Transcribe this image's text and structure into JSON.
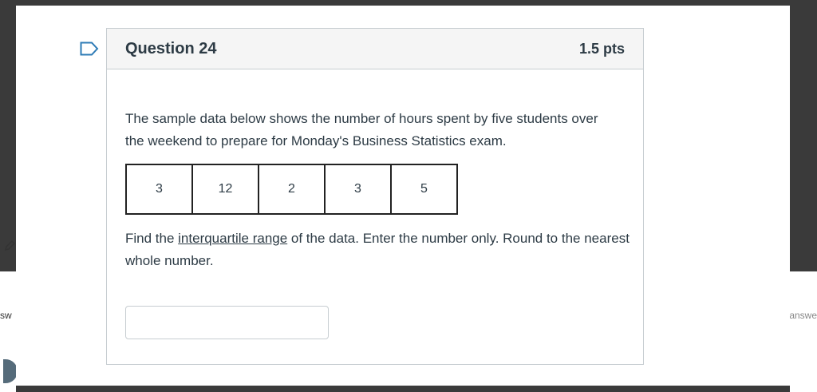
{
  "background": {
    "left_partial_text": "sw",
    "right_partial_text": "answe"
  },
  "question": {
    "title": "Question 24",
    "points": "1.5 pts",
    "prompt": "The sample data below shows the number of hours spent by five students over the weekend to prepare for Monday's Business Statistics exam.",
    "data_values": [
      "3",
      "12",
      "2",
      "3",
      "5"
    ],
    "instruction_before": "Find the ",
    "instruction_link": "interquartile range",
    "instruction_after": " of the data. Enter the number only. Round to the nearest whole number.",
    "answer_value": ""
  },
  "icons": {
    "flag": "bookmark-flag-icon",
    "pencil": "pencil-icon"
  },
  "colors": {
    "text": "#2d3b45",
    "border": "#c7cdd1",
    "header_bg": "#f5f5f5",
    "flag": "#2d7bb6"
  }
}
